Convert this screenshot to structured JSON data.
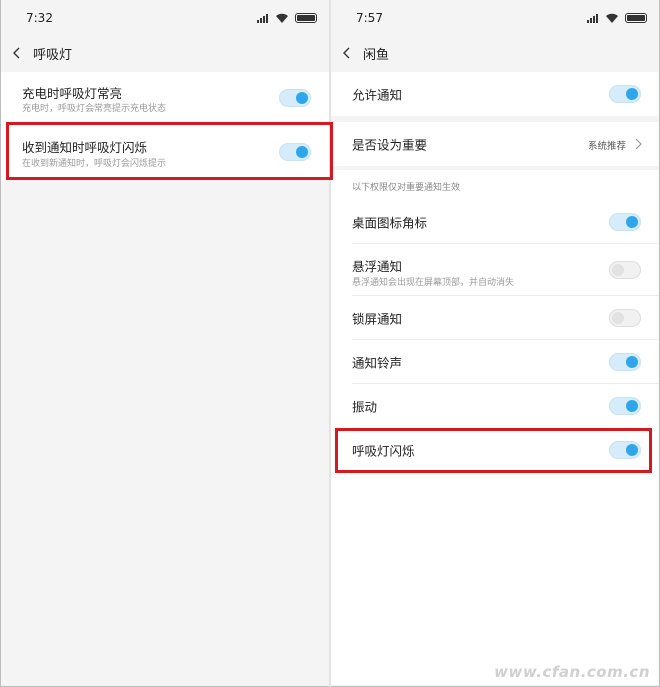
{
  "left": {
    "status": {
      "time": "7:32"
    },
    "title": "呼吸灯",
    "items": [
      {
        "label": "充电时呼吸灯常亮",
        "sub": "充电时，呼吸灯会常亮提示充电状态",
        "toggle": "on"
      },
      {
        "label": "收到通知时呼吸灯闪烁",
        "sub": "在收到新通知时，呼吸灯会闪烁提示",
        "toggle": "on"
      }
    ]
  },
  "right": {
    "status": {
      "time": "7:57"
    },
    "title": "闲鱼",
    "allow": {
      "label": "允许通知",
      "toggle": "on"
    },
    "important": {
      "label": "是否设为重要",
      "value": "系统推荐"
    },
    "section_hint": "以下权限仅对重要通知生效",
    "items": [
      {
        "label": "桌面图标角标",
        "toggle": "on"
      },
      {
        "label": "悬浮通知",
        "sub": "悬浮通知会出现在屏幕顶部，并自动消失",
        "toggle": "off"
      },
      {
        "label": "锁屏通知",
        "toggle": "off"
      },
      {
        "label": "通知铃声",
        "toggle": "on"
      },
      {
        "label": "振动",
        "toggle": "on"
      },
      {
        "label": "呼吸灯闪烁",
        "toggle": "on"
      }
    ]
  },
  "watermark": "www.cfan.com.cn",
  "colors": {
    "accent": "#2ea6ec",
    "highlight": "#d6191f",
    "background": "#f4f4f4"
  }
}
